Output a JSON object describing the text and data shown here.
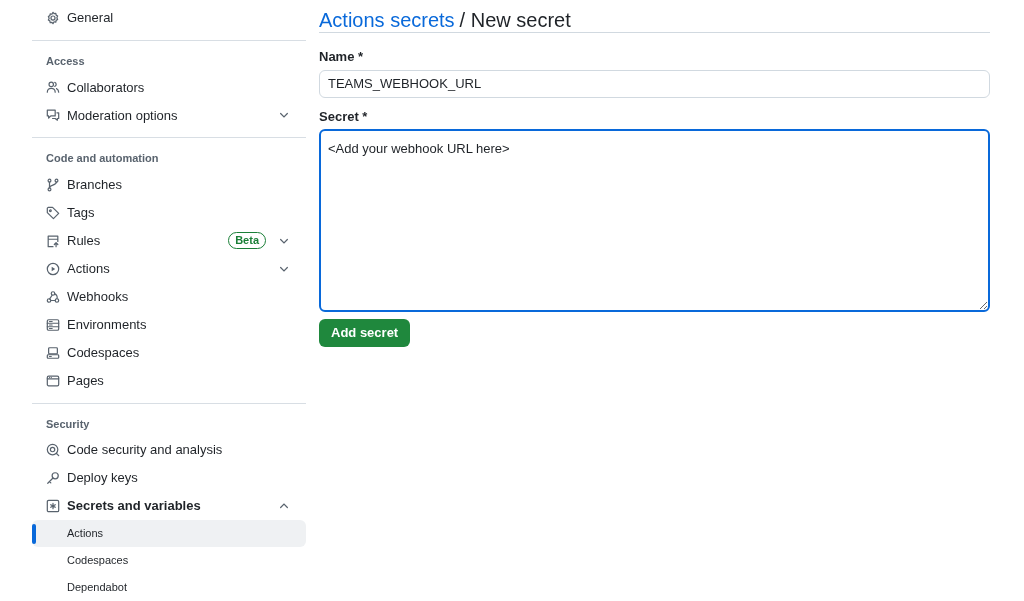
{
  "sidebar": {
    "sections": [
      {
        "items": [
          {
            "kind": "link",
            "label": "General"
          }
        ]
      },
      {
        "heading": "Access",
        "items": [
          {
            "kind": "link",
            "label": "Collaborators"
          },
          {
            "kind": "group",
            "label": "Moderation options",
            "expanded": false
          }
        ]
      },
      {
        "heading": "Code and automation",
        "items": [
          {
            "kind": "link",
            "label": "Branches"
          },
          {
            "kind": "link",
            "label": "Tags"
          },
          {
            "kind": "group",
            "label": "Rules",
            "badge": "Beta",
            "expanded": false
          },
          {
            "kind": "group",
            "label": "Actions",
            "expanded": false
          },
          {
            "kind": "link",
            "label": "Webhooks"
          },
          {
            "kind": "link",
            "label": "Environments"
          },
          {
            "kind": "link",
            "label": "Codespaces"
          },
          {
            "kind": "link",
            "label": "Pages"
          }
        ]
      },
      {
        "heading": "Security",
        "items": [
          {
            "kind": "link",
            "label": "Code security and analysis"
          },
          {
            "kind": "link",
            "label": "Deploy keys"
          },
          {
            "kind": "group",
            "label": "Secrets and variables",
            "expanded": true,
            "children": [
              {
                "label": "Actions",
                "selected": true
              },
              {
                "label": "Codespaces",
                "selected": false
              },
              {
                "label": "Dependabot",
                "selected": false
              }
            ]
          }
        ]
      }
    ]
  },
  "main": {
    "breadcrumb_link": "Actions secrets",
    "title": "/ New secret",
    "name_label": "Name *",
    "name_value": "TEAMS_WEBHOOK_URL",
    "secret_label": "Secret *",
    "secret_value": "<Add your webhook URL here>",
    "submit": "Add secret"
  }
}
